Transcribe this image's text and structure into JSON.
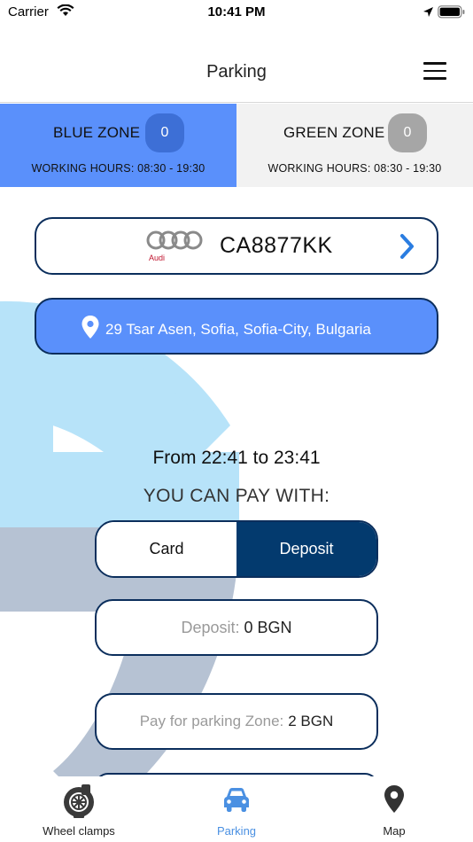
{
  "status_bar": {
    "carrier": "Carrier",
    "time": "10:41 PM"
  },
  "nav": {
    "title": "Parking"
  },
  "zones": [
    {
      "name": "BLUE ZONE",
      "count": "0",
      "hours": "WORKING HOURS:  08:30 - 19:30",
      "color": "#5a90fb"
    },
    {
      "name": "GREEN ZONE",
      "count": "0",
      "hours": "WORKING HOURS:  08:30 - 19:30",
      "color": "#f2f2f2"
    }
  ],
  "vehicle": {
    "brand": "Audi",
    "plate": "CA8877KK"
  },
  "address": {
    "text": "29 Tsar Asen, Sofia, Sofia-City, Bulgaria"
  },
  "session": {
    "time_range": "From 22:41 to 23:41",
    "pay_title": "YOU CAN PAY WITH:"
  },
  "payment_methods": {
    "card_label": "Card",
    "deposit_label": "Deposit",
    "selected": "Deposit"
  },
  "deposit_info": {
    "label": "Deposit:",
    "value": "0 BGN"
  },
  "zone_price": {
    "label": "Pay for parking Zone:",
    "value": "2 BGN"
  },
  "tabs": [
    {
      "label": "Wheel clamps",
      "icon": "wheel-clamp-icon"
    },
    {
      "label": "Parking",
      "icon": "car-icon",
      "active": true
    },
    {
      "label": "Map",
      "icon": "map-pin-icon"
    }
  ],
  "colors": {
    "accent_blue": "#5a90fb",
    "dark_navy": "#033a6e",
    "tab_active": "#4a90e2"
  }
}
